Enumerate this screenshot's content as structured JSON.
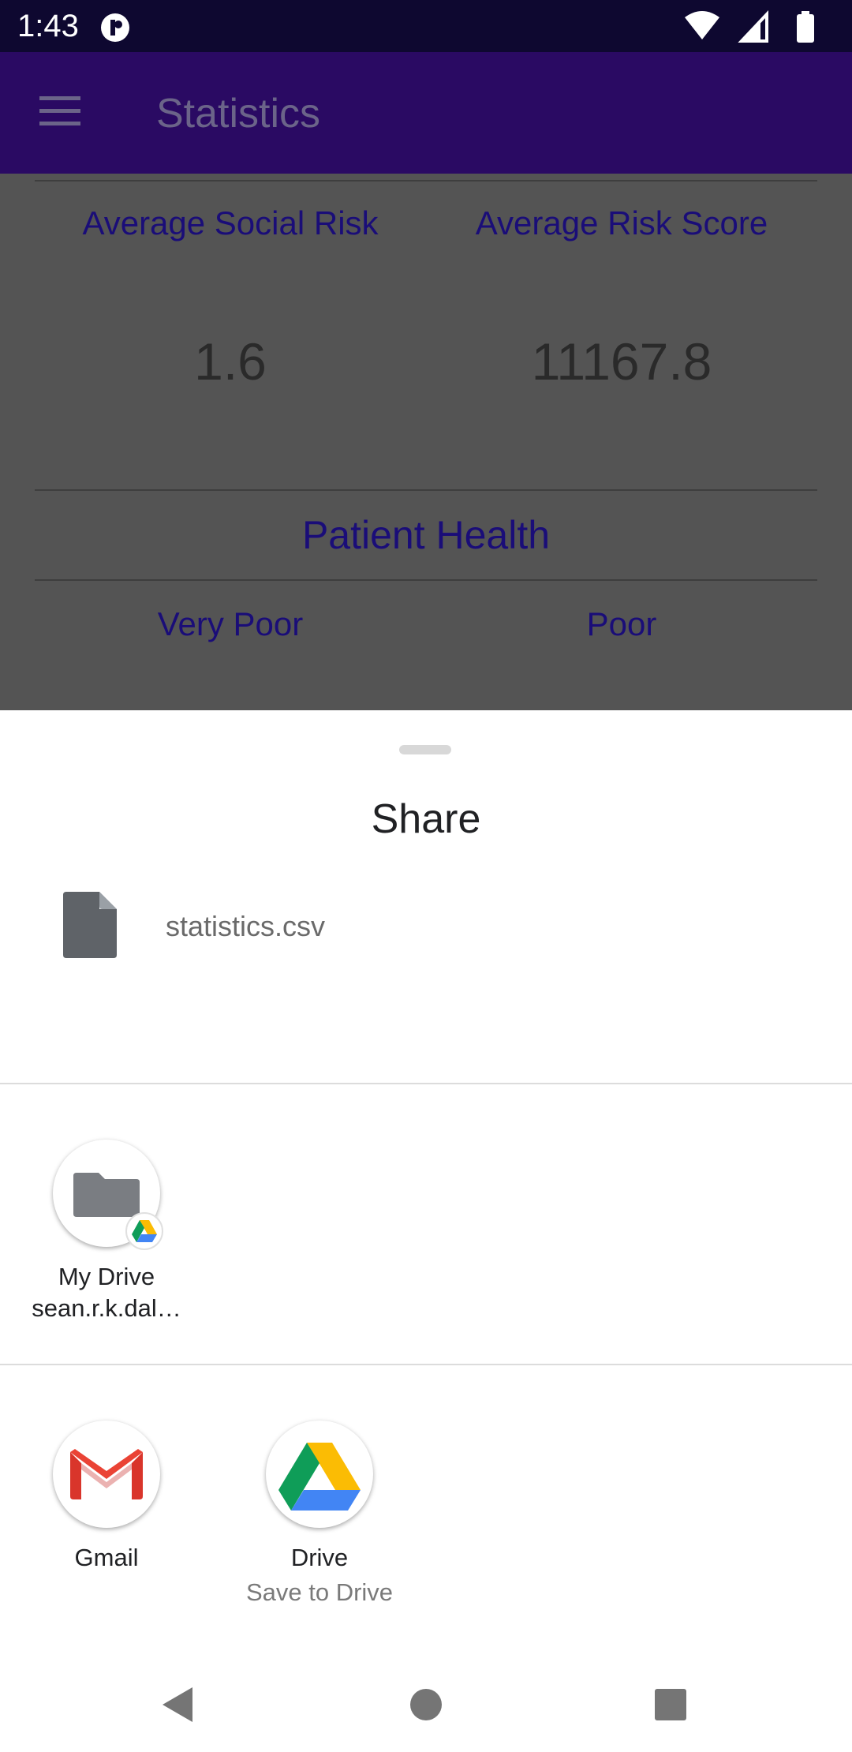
{
  "status_bar": {
    "time": "1:43",
    "icons": [
      "app-notification-icon",
      "wifi-icon",
      "signal-icon",
      "battery-icon"
    ]
  },
  "app_bar": {
    "title": "Statistics",
    "menu_icon": "hamburger-menu-icon",
    "background": "#2a0a63"
  },
  "stats": {
    "col1_label": "Average Social Risk",
    "col2_label": "Average Risk Score",
    "col1_value": "1.6",
    "col2_value": "11167.8",
    "section_title": "Patient Health",
    "health_col1": "Very Poor",
    "health_col2": "Poor"
  },
  "share_sheet": {
    "title": "Share",
    "file_name": "statistics.csv",
    "direct_share": [
      {
        "line1": "My Drive",
        "line2": "sean.r.k.dal…"
      }
    ],
    "apps": [
      {
        "name": "Gmail",
        "subtitle": ""
      },
      {
        "name": "Drive",
        "subtitle": "Save to Drive"
      }
    ]
  },
  "nav_bar": {
    "buttons": [
      "back-icon",
      "home-icon",
      "recents-icon"
    ]
  },
  "colors": {
    "status_bar": "#0e0830",
    "scrim_content": "#545454",
    "accent_text": "#1a0d78",
    "sheet_bg": "#ffffff"
  }
}
